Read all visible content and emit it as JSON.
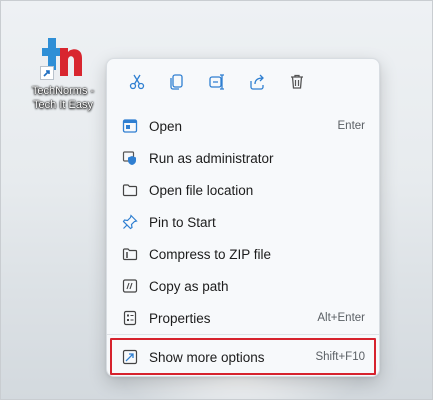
{
  "desktop": {
    "shortcut_label_line1": "TechNorms -",
    "shortcut_label_line2": "Tech It Easy",
    "logo_letters": "tn",
    "logo_colors": {
      "t": "#2f8fd6",
      "n": "#d8262f"
    }
  },
  "context_menu": {
    "quick_actions": [
      {
        "name": "cut-icon",
        "label": "Cut"
      },
      {
        "name": "copy-icon",
        "label": "Copy"
      },
      {
        "name": "rename-icon",
        "label": "Rename"
      },
      {
        "name": "share-icon",
        "label": "Share"
      },
      {
        "name": "delete-icon",
        "label": "Delete"
      }
    ],
    "items": [
      {
        "label": "Open",
        "shortcut": "Enter",
        "icon": "open-window-icon"
      },
      {
        "label": "Run as administrator",
        "shortcut": "",
        "icon": "shield-icon"
      },
      {
        "label": "Open file location",
        "shortcut": "",
        "icon": "folder-icon"
      },
      {
        "label": "Pin to Start",
        "shortcut": "",
        "icon": "pin-icon"
      },
      {
        "label": "Compress to ZIP file",
        "shortcut": "",
        "icon": "zip-folder-icon"
      },
      {
        "label": "Copy as path",
        "shortcut": "",
        "icon": "copy-path-icon"
      },
      {
        "label": "Properties",
        "shortcut": "Alt+Enter",
        "icon": "properties-icon"
      }
    ],
    "more_options": {
      "label": "Show more options",
      "shortcut": "Shift+F10",
      "icon": "expand-icon"
    }
  },
  "colors": {
    "accent": "#2f7fd1",
    "highlight_border": "#d6222d"
  }
}
